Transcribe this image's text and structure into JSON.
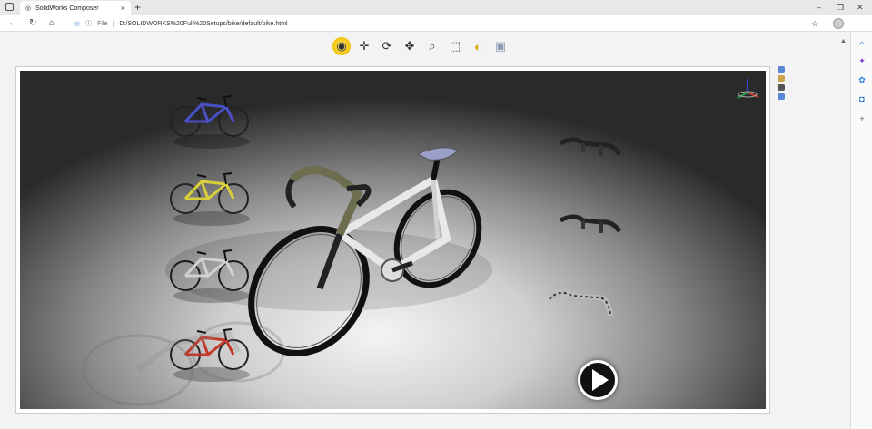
{
  "browser": {
    "tab_title": "SolidWorks Composer",
    "new_tab_glyph": "+",
    "url_scheme_label": "File",
    "url": "D:/SOLIDWORKS%20Full%20Setups/bike/default/bike.html",
    "window_controls": {
      "minimize": "–",
      "restore": "❐",
      "close": "✕"
    },
    "nav": {
      "back": "←",
      "reload": "↻",
      "home": "⌂"
    },
    "menu_glyph": "···"
  },
  "toolbar": {
    "tools": [
      {
        "name": "select-mode",
        "glyph": "◉"
      },
      {
        "name": "pan",
        "glyph": "✛"
      },
      {
        "name": "rotate",
        "glyph": "⟳"
      },
      {
        "name": "move",
        "glyph": "✥"
      },
      {
        "name": "zoom",
        "glyph": "⌕"
      },
      {
        "name": "zoom-area",
        "glyph": "⬚"
      },
      {
        "name": "lighting",
        "glyph": "◐"
      },
      {
        "name": "render",
        "glyph": "▣"
      }
    ]
  },
  "colors": {
    "bike_blue": "#4a4fc4",
    "bike_yellow": "#d8cf3a",
    "bike_white": "#e8e8e8",
    "bike_red": "#c23a2a",
    "toolbar_active": "#f2c200"
  },
  "thumbnails": {
    "bikes": [
      "blue-bike",
      "yellow-bike",
      "white-bike",
      "red-bike"
    ],
    "handlebars": [
      "handlebar-1",
      "handlebar-2",
      "handlebar-3"
    ]
  }
}
